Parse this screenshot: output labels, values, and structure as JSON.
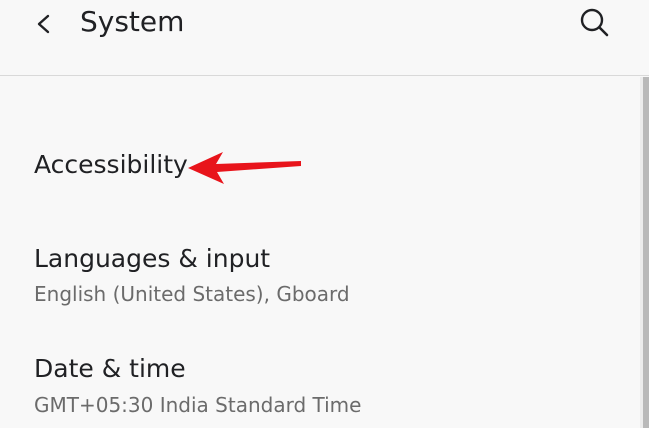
{
  "header": {
    "title": "System",
    "back_icon": "chevron-left-icon",
    "search_icon": "search-icon"
  },
  "items": [
    {
      "title": "Accessibility",
      "summary": ""
    },
    {
      "title": "Languages & input",
      "summary": "English (United States), Gboard"
    },
    {
      "title": "Date & time",
      "summary": "GMT+05:30 India Standard Time"
    }
  ],
  "colors": {
    "background": "#f8f8f8",
    "text_primary": "#202124",
    "text_secondary": "#6b6b6b",
    "annotation_arrow": "#e8141b"
  }
}
